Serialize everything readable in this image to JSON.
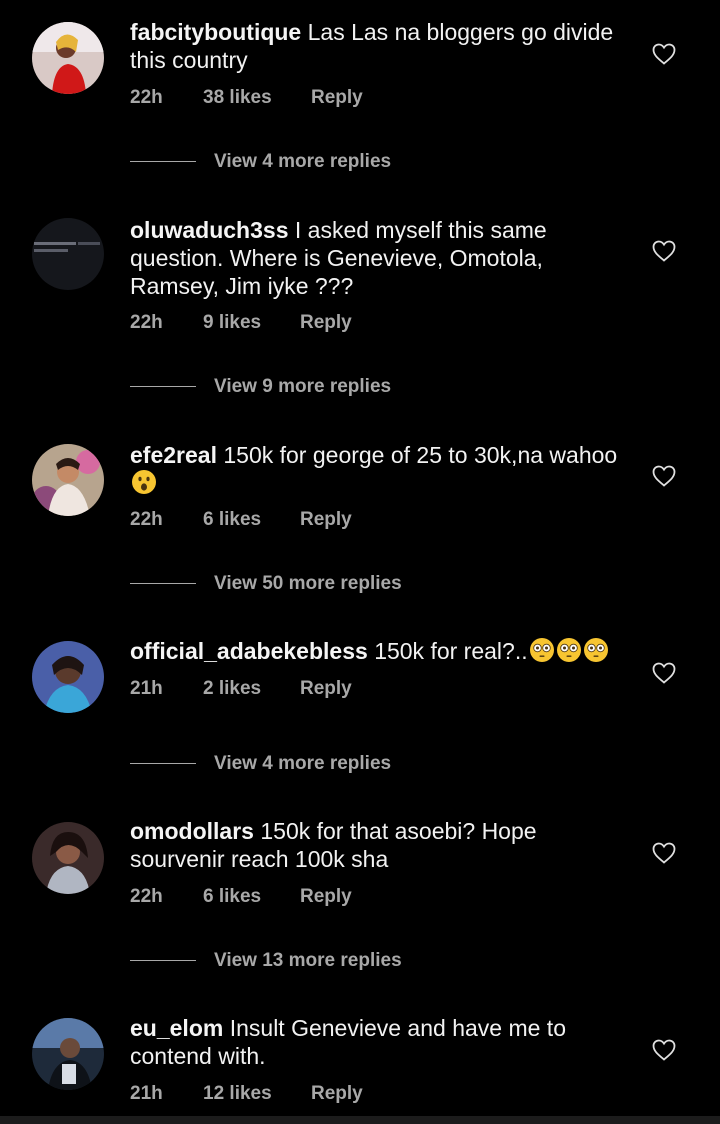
{
  "colors": {
    "background": "#000000",
    "text_primary": "#f5f5f5",
    "text_secondary": "#a8a8a8"
  },
  "comments": [
    {
      "username": "fabcityboutique",
      "text": "Las Las na bloggers go divide this country",
      "time": "22h",
      "likes": "38 likes",
      "reply": "Reply",
      "view_replies": "View 4 more replies",
      "avatar_icon": "avatar-photo-red-dress"
    },
    {
      "username": "oluwaduch3ss",
      "text": "I asked myself this same question. Where is Genevieve, Omotola, Ramsey, Jim iyke ???",
      "time": "22h",
      "likes": "9 likes",
      "reply": "Reply",
      "view_replies": "View 9 more replies",
      "avatar_icon": "avatar-dark-text-image"
    },
    {
      "username": "efe2real",
      "text": "150k for george of 25 to 30k,na wahoo",
      "time": "22h",
      "likes": "6 likes",
      "reply": "Reply",
      "view_replies": "View 50 more replies",
      "avatar_icon": "avatar-photo-woman",
      "emojis": [
        "astonished-face-emoji"
      ]
    },
    {
      "username": "official_adabekebless",
      "text": "150k for real?..",
      "time": "21h",
      "likes": "2 likes",
      "reply": "Reply",
      "view_replies": "View 4 more replies",
      "avatar_icon": "avatar-photo-woman-blue",
      "emojis": [
        "flushed-face-emoji",
        "flushed-face-emoji",
        "flushed-face-emoji"
      ]
    },
    {
      "username": "omodollars",
      "text": "150k for that asoebi? Hope sourvenir reach 100k sha",
      "time": "22h",
      "likes": "6 likes",
      "reply": "Reply",
      "view_replies": "View 13 more replies",
      "avatar_icon": "avatar-photo-woman-dark"
    },
    {
      "username": "eu_elom",
      "text": "Insult Genevieve and have me to contend with.",
      "time": "21h",
      "likes": "12 likes",
      "reply": "Reply",
      "avatar_icon": "avatar-photo-man"
    }
  ]
}
